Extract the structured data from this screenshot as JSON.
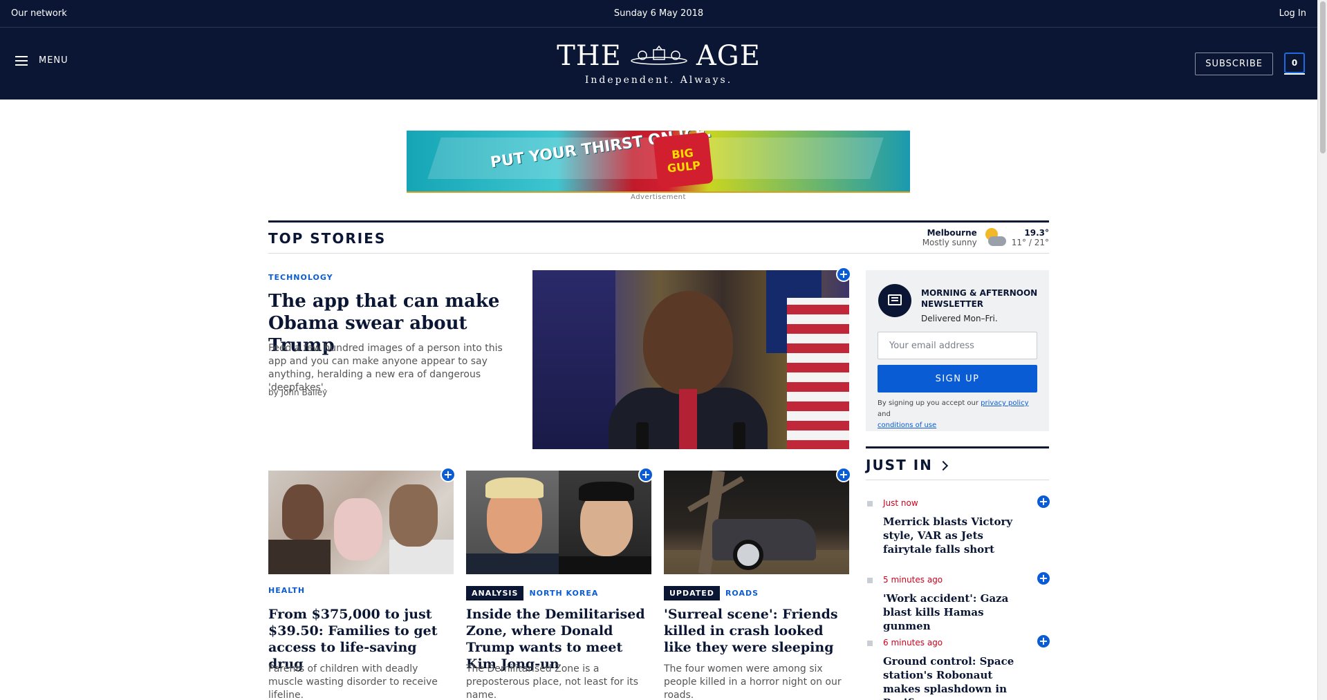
{
  "utility_bar": {
    "network": "Our network",
    "date": "Sunday 6 May 2018",
    "login": "Log In"
  },
  "masthead": {
    "menu_label": "MENU",
    "logo_left": "THE",
    "logo_right": "AGE",
    "tagline": "Independent. Always.",
    "subscribe_label": "SUBSCRIBE",
    "counter": "0"
  },
  "advertisement": {
    "slogan": "PUT YOUR THIRST ON ICE.",
    "product": "BIG GULP",
    "label": "Advertisement"
  },
  "top_stories": {
    "title": "TOP STORIES",
    "weather": {
      "city": "Melbourne",
      "condition": "Mostly sunny",
      "current": "19.3°",
      "range": "11° / 21°",
      "icon": "partly-cloudy-icon"
    },
    "lead": {
      "kicker": "TECHNOLOGY",
      "headline": "The app that can make Obama swear about Trump",
      "summary": "Feed a few hundred images of a person into this app and you can make anyone appear to say anything, heralding a new era of dangerous 'deepfakes'.",
      "byline": "by John Bailey"
    },
    "cards": [
      {
        "badge": "",
        "kicker": "HEALTH",
        "headline": "From $375,000 to just $39.50: Families to get access to life-saving drug",
        "summary": "Parents of children with deadly muscle wasting disorder to receive lifeline."
      },
      {
        "badge": "ANALYSIS",
        "kicker": "NORTH KOREA",
        "headline": "Inside the Demilitarised Zone, where Donald Trump wants to meet Kim Jong-un",
        "summary": "The Demilitarised Zone is a preposterous place, not least for its name."
      },
      {
        "badge": "UPDATED",
        "kicker": "ROADS",
        "headline": "'Surreal scene': Friends killed in crash looked like they were sleeping",
        "summary": "The four women were among six people killed in a horror night on our roads."
      }
    ]
  },
  "newsletter": {
    "title": "MORNING & AFTERNOON NEWSLETTER",
    "subtitle": "Delivered Mon–Fri.",
    "email_placeholder": "Your email address",
    "button": "SIGN UP",
    "terms_prefix": "By signing up you accept our",
    "privacy_link": "privacy policy",
    "terms_and": "and",
    "conditions_link": "conditions of use"
  },
  "just_in": {
    "title": "JUST IN",
    "items": [
      {
        "time": "Just now",
        "title": "Merrick blasts Victory style, VAR as Jets fairytale falls short"
      },
      {
        "time": "5 minutes ago",
        "title": "'Work accident': Gaza blast kills Hamas gunmen"
      },
      {
        "time": "6 minutes ago",
        "title": "Ground control: Space station's Robonaut makes splashdown in Pacific"
      }
    ]
  },
  "colors": {
    "navy": "#0a1633",
    "accent_blue": "#0a5cd5",
    "timestamp_red": "#d0021b"
  }
}
